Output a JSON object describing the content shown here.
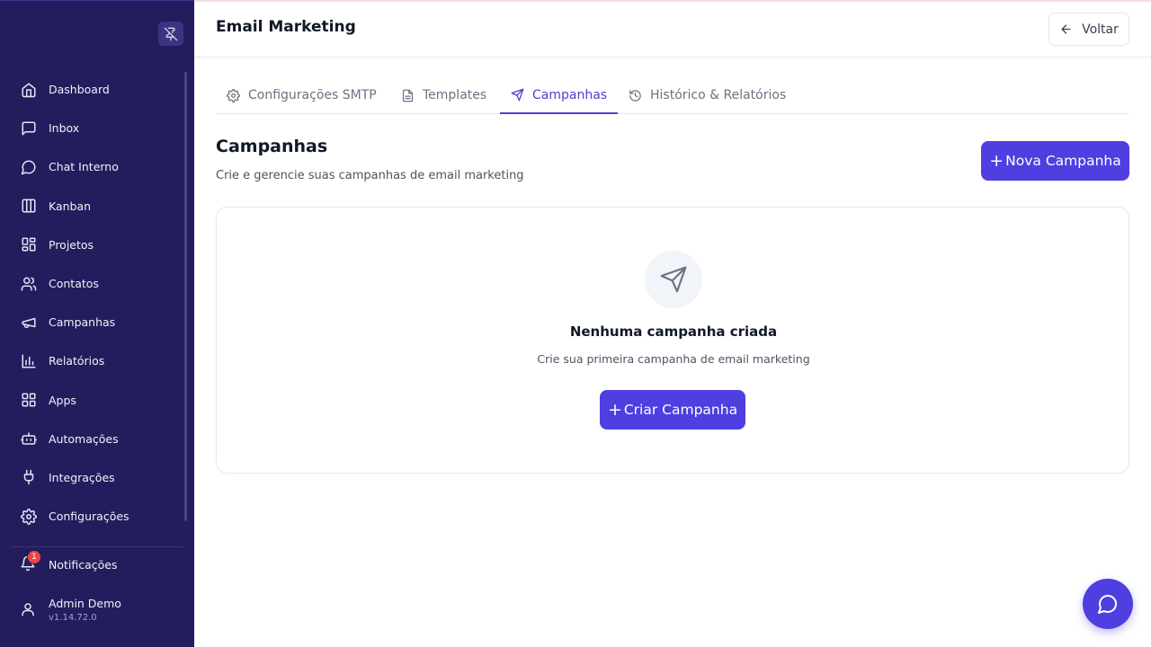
{
  "sidebar": {
    "items": [
      {
        "label": "Dashboard",
        "icon": "home-icon"
      },
      {
        "label": "Inbox",
        "icon": "message-square-icon"
      },
      {
        "label": "Chat Interno",
        "icon": "message-circle-icon"
      },
      {
        "label": "Kanban",
        "icon": "kanban-icon"
      },
      {
        "label": "Projetos",
        "icon": "layout-dashboard-icon"
      },
      {
        "label": "Contatos",
        "icon": "users-icon"
      },
      {
        "label": "Campanhas",
        "icon": "megaphone-icon"
      },
      {
        "label": "Relatórios",
        "icon": "bar-chart-icon"
      },
      {
        "label": "Apps",
        "icon": "apps-grid-icon"
      },
      {
        "label": "Automações",
        "icon": "bot-icon"
      },
      {
        "label": "Integrações",
        "icon": "plug-icon"
      },
      {
        "label": "Configurações",
        "icon": "gear-icon"
      }
    ],
    "notifications": {
      "label": "Notificações",
      "count": "1"
    },
    "user": {
      "name": "Admin Demo",
      "version": "v1.14.72.0"
    }
  },
  "header": {
    "title": "Email Marketing",
    "back_label": "Voltar"
  },
  "tabs": [
    {
      "label": "Configurações SMTP",
      "icon": "gear-icon",
      "active": false
    },
    {
      "label": "Templates",
      "icon": "file-text-icon",
      "active": false
    },
    {
      "label": "Campanhas",
      "icon": "send-icon",
      "active": true
    },
    {
      "label": "Histórico & Relatórios",
      "icon": "history-icon",
      "active": false
    }
  ],
  "main": {
    "title": "Campanhas",
    "subtitle": "Crie e gerencie suas campanhas de email marketing",
    "new_button": "Nova Campanha",
    "empty": {
      "title": "Nenhuma campanha criada",
      "subtitle": "Crie sua primeira campanha de email marketing",
      "button": "Criar Campanha"
    }
  },
  "colors": {
    "sidebar_bg": "#231d5e",
    "accent": "#4f3ee0",
    "active_tab": "#4f3fd0",
    "badge": "#ef4444"
  }
}
